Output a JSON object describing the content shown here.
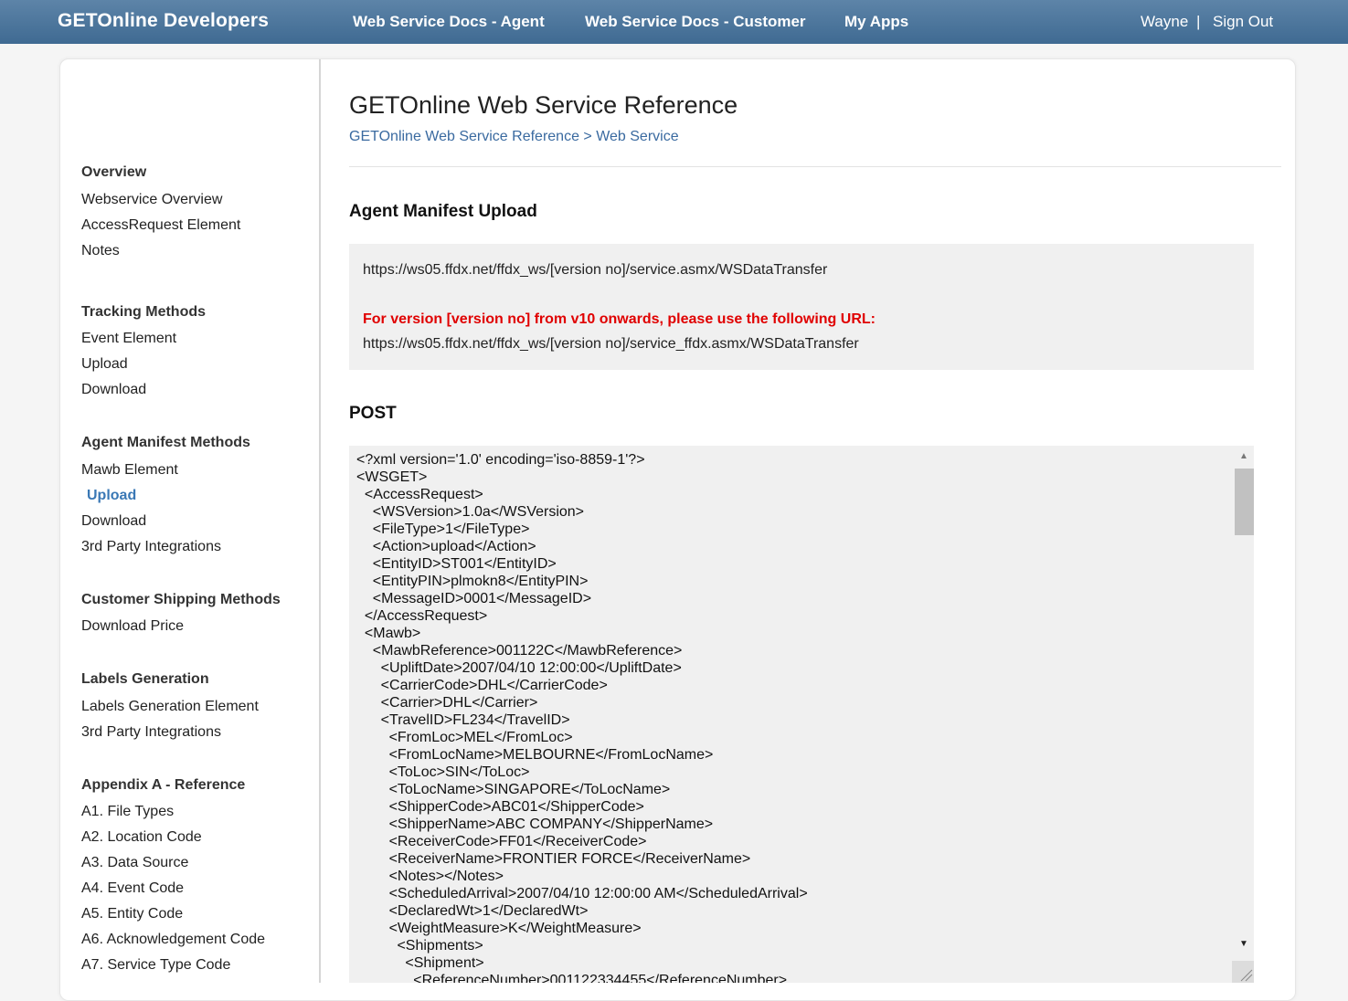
{
  "topbar": {
    "brand": "GETOnline Developers",
    "nav": [
      "Web Service Docs - Agent",
      "Web Service Docs - Customer",
      "My Apps"
    ],
    "user": "Wayne",
    "separator": "|",
    "signout": "Sign Out"
  },
  "sidebar": {
    "sections": [
      {
        "heading": "Overview",
        "items": [
          "Webservice Overview",
          "AccessRequest Element",
          "Notes"
        ]
      },
      {
        "heading": "Tracking Methods",
        "items": [
          "Event Element",
          "Upload",
          "Download"
        ]
      },
      {
        "heading": "Agent Manifest Methods",
        "items": [
          "Mawb Element",
          "Upload",
          "Download",
          "3rd Party Integrations"
        ]
      },
      {
        "heading": "Customer Shipping Methods",
        "items": [
          "Download Price"
        ]
      },
      {
        "heading": "Labels Generation",
        "items": [
          "Labels Generation Element",
          "3rd Party Integrations"
        ]
      },
      {
        "heading": "Appendix A - Reference",
        "items": [
          "A1. File Types",
          "A2. Location Code",
          "A3. Data Source",
          "A4. Event Code",
          "A5. Entity Code",
          "A6. Acknowledgement Code",
          "A7. Service Type Code"
        ]
      }
    ],
    "active_item": "Agent Manifest Methods / Upload"
  },
  "main": {
    "title": "GETOnline Web Service Reference",
    "breadcrumb": {
      "parent": "GETOnline Web Service Reference",
      "sep": " > ",
      "current": "Web Service"
    },
    "section_title": "Agent Manifest Upload",
    "url_box": {
      "url1": "https://ws05.ffdx.net/ffdx_ws/[version no]/service.asmx/WSDataTransfer",
      "notice": "For version [version no] from v10 onwards, please use the following URL:",
      "url2": "https://ws05.ffdx.net/ffdx_ws/[version no]/service_ffdx.asmx/WSDataTransfer"
    },
    "post_title": "POST",
    "post_body": "<?xml version='1.0' encoding='iso-8859-1'?>\n<WSGET>\n  <AccessRequest>\n    <WSVersion>1.0a</WSVersion>\n    <FileType>1</FileType>\n    <Action>upload</Action>\n    <EntityID>ST001</EntityID>\n    <EntityPIN>plmokn8</EntityPIN>\n    <MessageID>0001</MessageID>\n  </AccessRequest>\n  <Mawb>\n    <MawbReference>001122C</MawbReference>\n      <UpliftDate>2007/04/10 12:00:00</UpliftDate>\n      <CarrierCode>DHL</CarrierCode>\n      <Carrier>DHL</Carrier>\n      <TravelID>FL234</TravelID>\n        <FromLoc>MEL</FromLoc>\n        <FromLocName>MELBOURNE</FromLocName>\n        <ToLoc>SIN</ToLoc>\n        <ToLocName>SINGAPORE</ToLocName>\n        <ShipperCode>ABC01</ShipperCode>\n        <ShipperName>ABC COMPANY</ShipperName>\n        <ReceiverCode>FF01</ReceiverCode>\n        <ReceiverName>FRONTIER FORCE</ReceiverName>\n        <Notes></Notes>\n        <ScheduledArrival>2007/04/10 12:00:00 AM</ScheduledArrival>\n        <DeclaredWt>1</DeclaredWt>\n        <WeightMeasure>K</WeightMeasure>\n          <Shipments>\n            <Shipment>\n              <ReferenceNumber>001122334455</ReferenceNumber>"
  },
  "colors": {
    "topbar": "#4a739b",
    "link": "#3a6aa0",
    "active": "#3a78b5",
    "warning": "#e00000",
    "box_bg": "#f0f0f0"
  },
  "icons": {
    "scroll_up": "triangle-up",
    "scroll_down": "triangle-down",
    "resize": "resize-grip"
  }
}
